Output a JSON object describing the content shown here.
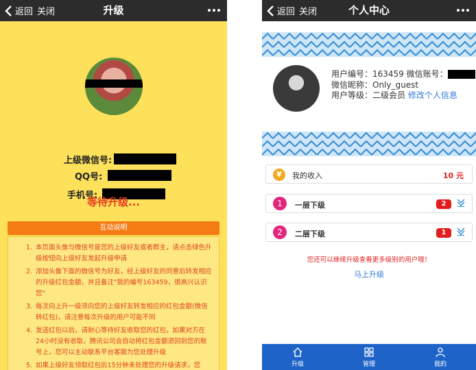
{
  "left": {
    "nav": {
      "back_label": "返回",
      "close_label": "关闭",
      "title": "升级"
    },
    "fields": [
      {
        "label": "上级微信号:"
      },
      {
        "label": "QQ号:"
      },
      {
        "label": "手机号:"
      }
    ],
    "status": "等待升级...",
    "help_title": "互动说明",
    "rules": [
      {
        "num": "1.",
        "text": "本页面头像与微信号是您的上级好友或者群主，请点击绿色升级按钮向上级好友发起升级申请"
      },
      {
        "num": "2.",
        "text": "添加头像下面的微信号为好友，经上级好友的同意后转发相应的升级红包金额，并且备注\"我的编号163459，很高兴认识您\""
      },
      {
        "num": "3.",
        "text": "每次向上升一级须向您的上级好友转发相应的红包金额(微信转红包)，请注意每次升级的用户可能不同"
      },
      {
        "num": "4.",
        "text": "发送红包以后，请耐心等待好友收取您的红包，如果对方在24小时没有收取，腾讯公司会自动将红包金额退回到您的账号上，您可以主动联系平台客服为您处理升级"
      },
      {
        "num": "5.",
        "text": "如果上级好友领取红包后15分钟未处理您的升级请求，您"
      }
    ]
  },
  "right": {
    "nav": {
      "back_label": "返回",
      "close_label": "关闭",
      "title": "个人中心"
    },
    "profile": {
      "line1": "用户编号：163459 微信账号：",
      "line2": "微信昵称：Only_guest",
      "line3_prefix": "用户等级：二级会员",
      "edit_link": "修改个人信息"
    },
    "income": {
      "icon": "¥",
      "label": "我的收入",
      "amount": "10 元"
    },
    "levels": [
      {
        "num": "1",
        "label": "一层下级",
        "count": "2"
      },
      {
        "num": "2",
        "label": "二层下级",
        "count": "1"
      }
    ],
    "notice": "您还可以继续升级查看更多级别的用户哦！",
    "upgrade_link": "马上升级",
    "tabs": [
      {
        "label": "升级",
        "icon": "home-icon"
      },
      {
        "label": "管理",
        "icon": "grid-icon"
      },
      {
        "label": "我的",
        "icon": "user-icon"
      }
    ]
  },
  "colors": {
    "nav": "#2c2c2c",
    "left_bg": "#fde15a",
    "accent_orange": "#f57c14",
    "red": "#e21d1d",
    "blue": "#2e7bd8",
    "tabbar": "#1e64c8",
    "magenta": "#e3267b"
  }
}
